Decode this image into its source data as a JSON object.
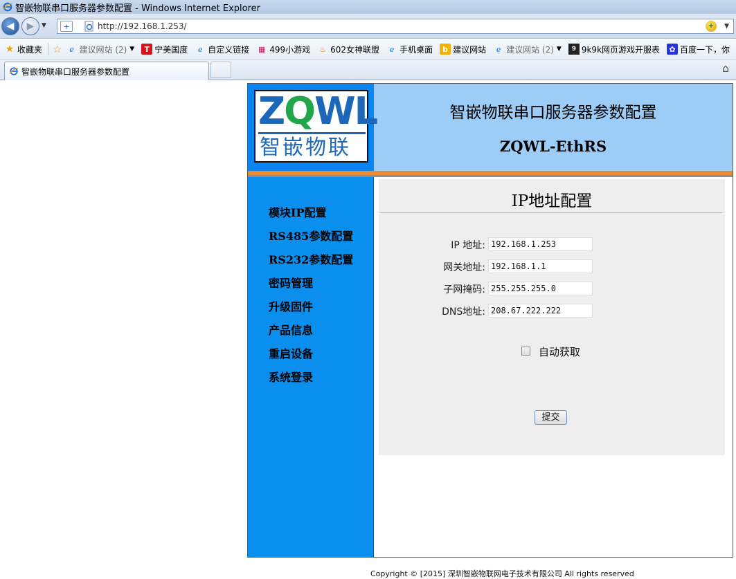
{
  "window": {
    "title": "智嵌物联串口服务器参数配置 - Windows Internet Explorer"
  },
  "address_bar": {
    "url": "http://192.168.1.253/"
  },
  "favorites": {
    "label": "收藏夹",
    "items": [
      {
        "label": "建议网站 (2)",
        "icon": "ie-page-icon",
        "dimmed": true,
        "dropdown": true
      },
      {
        "label": "宁美国度",
        "icon": "t-red-icon"
      },
      {
        "label": "自定义链接",
        "icon": "ie-page-icon"
      },
      {
        "label": "499小游戏",
        "icon": "game-icon"
      },
      {
        "label": "602女神联盟",
        "icon": "flame-icon"
      },
      {
        "label": "手机桌面",
        "icon": "ie-page-icon"
      },
      {
        "label": "建议网站",
        "icon": "bing-icon"
      },
      {
        "label": "建议网站 (2)",
        "icon": "ie-page-icon",
        "dimmed": true,
        "dropdown": true
      },
      {
        "label": "9k9k网页游戏开服表",
        "icon": "9k-icon"
      },
      {
        "label": "百度一下，你",
        "icon": "baidu-paw-icon"
      }
    ]
  },
  "tab": {
    "label": "智嵌物联串口服务器参数配置"
  },
  "page": {
    "header": {
      "logo_text": "ZQWL",
      "logo_cn": "智嵌物联",
      "title": "智嵌物联串口服务器参数配置",
      "subtitle": "ZQWL-EthRS"
    },
    "menu": [
      "模块IP配置",
      "RS485参数配置",
      "RS232参数配置",
      "密码管理",
      "升级固件",
      "产品信息",
      "重启设备",
      "系统登录"
    ],
    "form": {
      "title": "IP地址配置",
      "fields": [
        {
          "label": "IP 地址:",
          "value": "192.168.1.253"
        },
        {
          "label": "网关地址:",
          "value": "192.168.1.1"
        },
        {
          "label": "子网掩码:",
          "value": "255.255.255.0"
        },
        {
          "label": "DNS地址:",
          "value": "208.67.222.222"
        }
      ],
      "auto_label": "自动获取",
      "auto_checked": false,
      "submit_label": "提交"
    },
    "footer": "Copyright © [2015] 深圳智嵌物联网电子技术有限公司 All rights reserved"
  }
}
